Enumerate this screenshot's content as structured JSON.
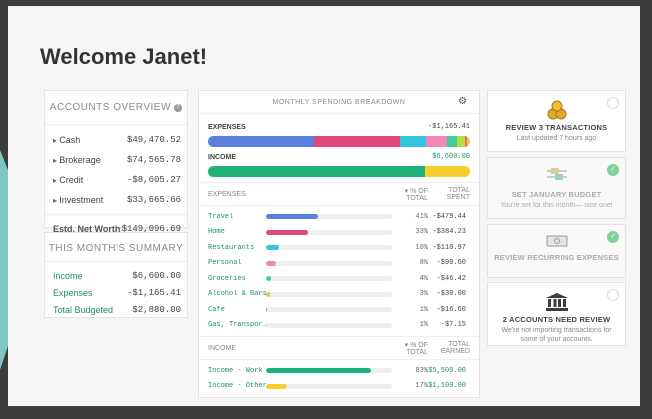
{
  "page": {
    "title": "Welcome Janet!"
  },
  "accounts": {
    "header": "ACCOUNTS OVERVIEW",
    "rows": [
      {
        "label": "Cash",
        "value": "$49,470.52"
      },
      {
        "label": "Brokerage",
        "value": "$74,565.78"
      },
      {
        "label": "Credit",
        "value": "-$8,605.27"
      },
      {
        "label": "Investment",
        "value": "$33,665.66"
      }
    ],
    "net_label": "Estd. Net Worth",
    "net_value": "$149,096.69"
  },
  "summary": {
    "header": "THIS MONTH'S SUMMARY",
    "rows": [
      {
        "label": "Income",
        "value": "$6,600.00"
      },
      {
        "label": "Expenses",
        "value": "-$1,165.41"
      },
      {
        "label": "Total Budgeted",
        "value": "$2,880.00"
      }
    ]
  },
  "spending": {
    "header": "MONTHLY SPENDING BREAKDOWN",
    "expenses_label": "EXPENSES",
    "expenses_total": "-$1,165.41",
    "income_label": "INCOME",
    "income_total": "$6,600.00",
    "expense_col": {
      "name": "EXPENSES",
      "pct1": "▾ % OF",
      "pct2": "TOTAL",
      "tot1": "TOTAL",
      "tot2": "SPENT"
    },
    "income_col": {
      "name": "INCOME",
      "pct1": "▾ % OF",
      "pct2": "TOTAL",
      "tot1": "TOTAL",
      "tot2": "EARNED"
    },
    "expense_rows": [
      {
        "name": "Travel",
        "pct": "41%",
        "amount": "-$479.44",
        "fraction": 0.41,
        "color": "#5b7fdc"
      },
      {
        "name": "Home",
        "pct": "33%",
        "amount": "-$384.23",
        "fraction": 0.33,
        "color": "#e0487f"
      },
      {
        "name": "Restaurants",
        "pct": "10%",
        "amount": "-$110.97",
        "fraction": 0.1,
        "color": "#33c5de"
      },
      {
        "name": "Personal",
        "pct": "8%",
        "amount": "-$90.60",
        "fraction": 0.08,
        "color": "#f287b5"
      },
      {
        "name": "Groceries",
        "pct": "4%",
        "amount": "-$46.42",
        "fraction": 0.04,
        "color": "#3fcf96"
      },
      {
        "name": "Alcohol & Bars",
        "pct": "3%",
        "amount": "-$30.00",
        "fraction": 0.03,
        "color": "#b6dc4a"
      },
      {
        "name": "Cafe",
        "pct": "1%",
        "amount": "-$16.60",
        "fraction": 0.01,
        "color": "#f26b6b"
      },
      {
        "name": "Gas, Transpor…",
        "pct": "1%",
        "amount": "-$7.15",
        "fraction": 0.01,
        "color": "#f2c94c"
      }
    ],
    "income_rows": [
      {
        "name": "Income - Work",
        "pct": "83%",
        "amount": "$5,500.00",
        "fraction": 0.83,
        "color": "#1eb37a"
      },
      {
        "name": "Income - Other",
        "pct": "17%",
        "amount": "$1,100.00",
        "fraction": 0.17,
        "color": "#f5cf2c"
      }
    ]
  },
  "tasks": [
    {
      "title": "REVIEW 3 TRANSACTIONS",
      "subtitle": "Last updated 7 hours ago",
      "done": false,
      "icon": "coins-icon"
    },
    {
      "title": "SET JANUARY BUDGET",
      "subtitle": "You're set for this month— nice one!",
      "done": true,
      "icon": "sliders-icon"
    },
    {
      "title": "REVIEW RECURRING EXPENSES",
      "subtitle": "",
      "done": true,
      "icon": "dollar-bill-icon"
    },
    {
      "title": "2 ACCOUNTS NEED REVIEW",
      "subtitle": "We're not importing transactions for some of your accounts.",
      "done": false,
      "icon": "bank-icon"
    }
  ]
}
